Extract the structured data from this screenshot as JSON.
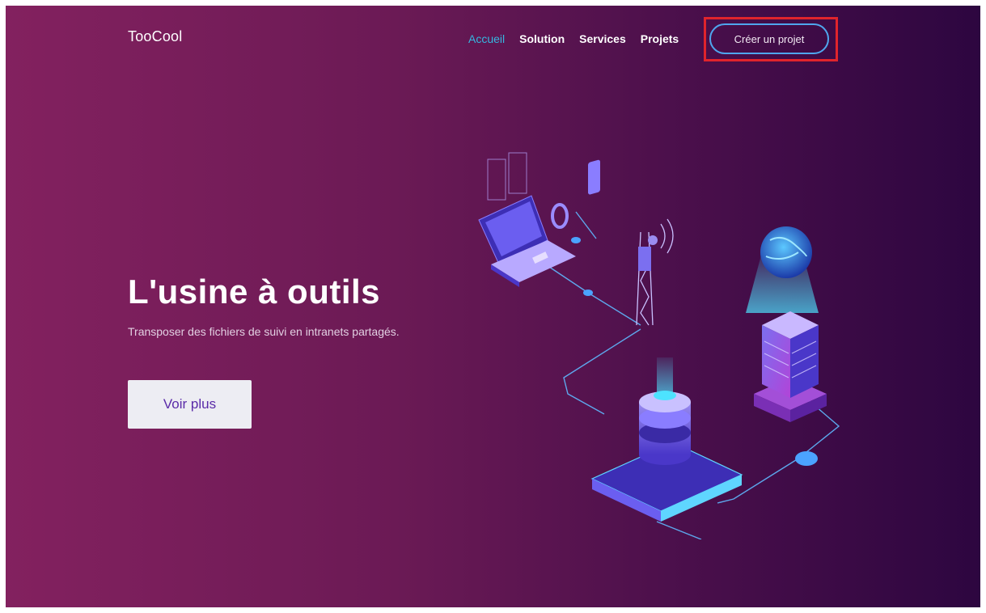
{
  "header": {
    "logo": "TooCool",
    "nav": [
      {
        "label": "Accueil",
        "active": true
      },
      {
        "label": "Solution",
        "active": false
      },
      {
        "label": "Services",
        "active": false
      },
      {
        "label": "Projets",
        "active": false
      }
    ],
    "cta_label": "Créer un projet"
  },
  "hero": {
    "title": "L'usine à outils",
    "subtitle": "Transposer des fichiers de suivi en intranets partagés.",
    "button_label": "Voir plus"
  },
  "colors": {
    "gradient_start": "#83215f",
    "gradient_end": "#2d0640",
    "nav_active": "#35b7e0",
    "cta_border": "#4fa6ee",
    "highlight_box": "#e0242c",
    "button_text": "#5a2ba8"
  },
  "illustration": {
    "icons": [
      "laptop-icon",
      "watch-icon",
      "phone-icon",
      "antenna-tower-icon",
      "globe-icon",
      "server-building-icon",
      "database-stack-icon"
    ]
  }
}
